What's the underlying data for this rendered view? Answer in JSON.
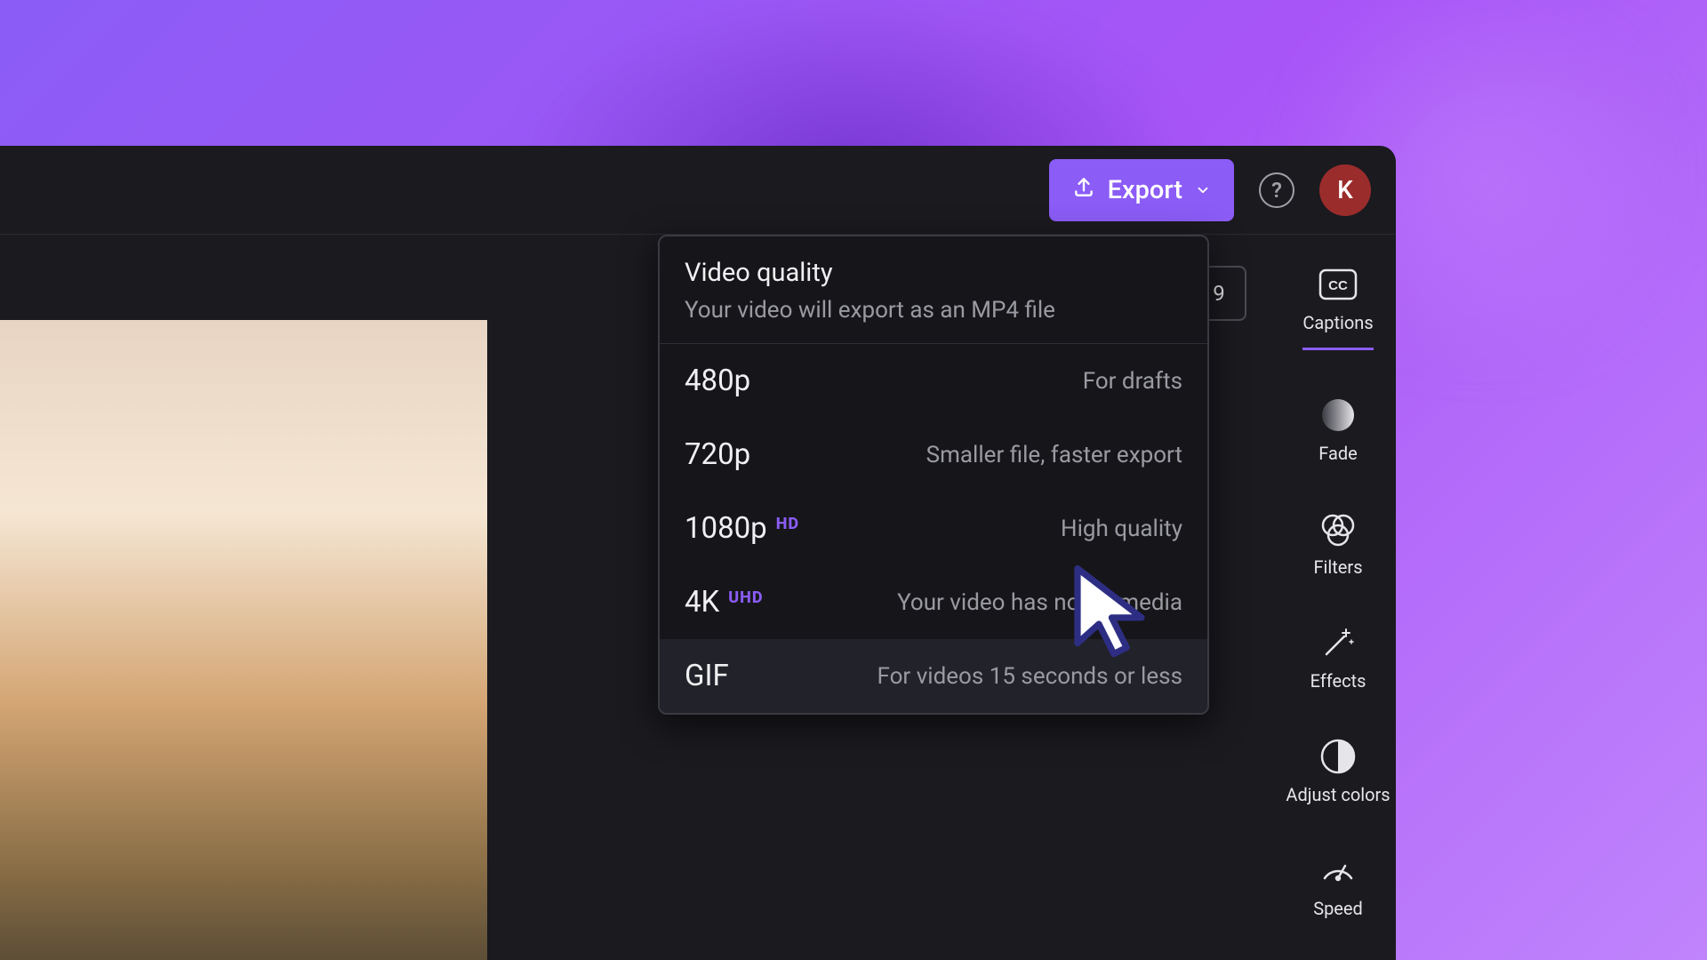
{
  "topbar": {
    "export_label": "Export",
    "help_symbol": "?",
    "avatar_initial": "K"
  },
  "aspect_chip": "9",
  "dropdown": {
    "title": "Video quality",
    "subtitle": "Your video will export as an MP4 file",
    "options": [
      {
        "label": "480p",
        "badge": "",
        "badge_class": "",
        "desc": "For drafts",
        "hovered": false
      },
      {
        "label": "720p",
        "badge": "",
        "badge_class": "",
        "desc": "Smaller file, faster export",
        "hovered": false
      },
      {
        "label": "1080p",
        "badge": "HD",
        "badge_class": "hd",
        "desc": "High quality",
        "hovered": false
      },
      {
        "label": "4K",
        "badge": "UHD",
        "badge_class": "uhd",
        "desc": "Your video has no 4K media",
        "hovered": false
      },
      {
        "label": "GIF",
        "badge": "",
        "badge_class": "",
        "desc": "For videos 15 seconds or less",
        "hovered": true
      }
    ]
  },
  "rail": {
    "items": [
      {
        "name": "captions",
        "label": "Captions",
        "active": true
      },
      {
        "name": "fade",
        "label": "Fade",
        "active": false
      },
      {
        "name": "filters",
        "label": "Filters",
        "active": false
      },
      {
        "name": "effects",
        "label": "Effects",
        "active": false
      },
      {
        "name": "adjust-colors",
        "label": "Adjust colors",
        "active": false
      },
      {
        "name": "speed",
        "label": "Speed",
        "active": false
      }
    ]
  }
}
